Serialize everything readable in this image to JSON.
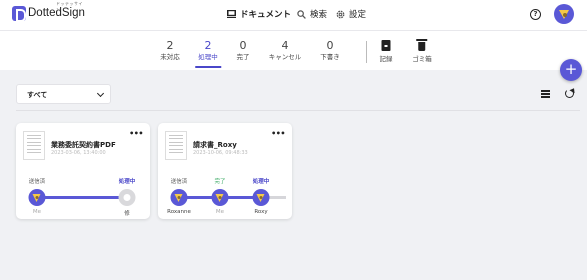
{
  "header": {
    "logo_text": "DottedSign",
    "logo_ruby": "ドッテッサイン",
    "nav": [
      {
        "label": "ドキュメント",
        "icon": "document-icon"
      },
      {
        "label": "検索",
        "icon": "search-icon"
      },
      {
        "label": "設定",
        "icon": "gear-icon"
      }
    ],
    "help_label": "?"
  },
  "status_tabs": [
    {
      "count": "2",
      "label": "未対応"
    },
    {
      "count": "2",
      "label": "処理中",
      "active": true
    },
    {
      "count": "0",
      "label": "完了"
    },
    {
      "count": "4",
      "label": "キャンセル"
    },
    {
      "count": "0",
      "label": "下書き"
    }
  ],
  "icon_tabs": [
    {
      "label": "記録",
      "icon": "archive-icon"
    },
    {
      "label": "ゴミ箱",
      "icon": "trash-icon"
    }
  ],
  "fab_label": "+",
  "filter": {
    "selected": "すべて"
  },
  "cards": [
    {
      "title": "業務委託契約書PDF",
      "date": "2023-03-06, 13:40:00",
      "steps": [
        {
          "status": "送信済",
          "name": "Me"
        },
        {
          "status": "処理中",
          "name": "修"
        }
      ]
    },
    {
      "title": "請求書_Roxy",
      "date": "2023-10-06, 09:48:33",
      "steps": [
        {
          "status": "送信済",
          "name": "Roxanne"
        },
        {
          "status": "完了",
          "name": "Me"
        },
        {
          "status": "処理中",
          "name": "Roxy"
        }
      ]
    }
  ],
  "colors": {
    "accent": "#5a58d6",
    "active_tab": "#4a47c9",
    "done": "#2ea45a",
    "avatar_face": "#f5c949"
  }
}
